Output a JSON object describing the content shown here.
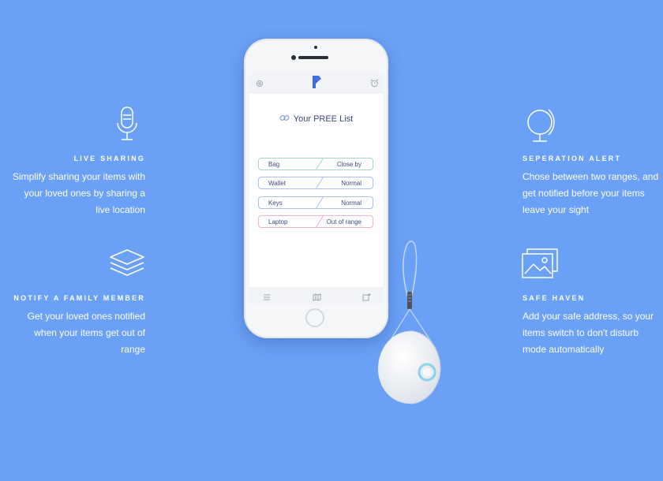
{
  "features": {
    "live_sharing": {
      "title": "LIVE SHARING",
      "desc": [
        "Simplify sharing your items with",
        "your loved ones by sharing a",
        "live location"
      ]
    },
    "notify_family": {
      "title": "NOTIFY A FAMILY MEMBER",
      "desc": [
        "Get your loved ones notified",
        "when your items get out of",
        "range"
      ]
    },
    "separation_alert": {
      "title": "SEPERATION ALERT",
      "desc": [
        "Chose between two ranges, and",
        "get notified before your items",
        "leave your sight"
      ]
    },
    "safe_haven": {
      "title": "SAFE HAVEN",
      "desc": [
        "Add your safe address, so your",
        "items switch to don't disturb",
        "mode automatically"
      ]
    }
  },
  "app": {
    "list_title": "Your PREE List",
    "items": [
      {
        "name": "Bag",
        "status": "Close by"
      },
      {
        "name": "Wallet",
        "status": "Normal"
      },
      {
        "name": "Keys",
        "status": "Normal"
      },
      {
        "name": "Laptop",
        "status": "Out of range"
      }
    ]
  },
  "colors": {
    "background": "#6aa0f6",
    "accent_blue": "#3f6fe0",
    "close_by_border": "#a6d6c8",
    "normal_border": "#a9c3e6",
    "out_of_range_border": "#e7b6d3"
  },
  "icons": {
    "live_sharing": "microphone-icon",
    "notify_family": "layers-icon",
    "separation_alert": "globe-icon",
    "safe_haven": "image-gallery-icon"
  }
}
